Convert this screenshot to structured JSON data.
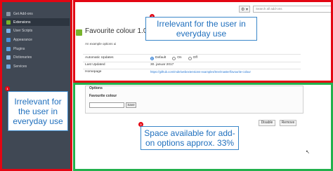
{
  "sidebar": {
    "items": [
      {
        "label": "Get Add-ons",
        "icon": "get-addons-icon",
        "color": "#8a95a3",
        "active": false
      },
      {
        "label": "Extensions",
        "icon": "extensions-icon",
        "color": "#78b32c",
        "active": true
      },
      {
        "label": "User Scripts",
        "icon": "user-scripts-icon",
        "color": "#7bb0e6",
        "active": false
      },
      {
        "label": "Appearance",
        "icon": "appearance-icon",
        "color": "#4a90d9",
        "active": false
      },
      {
        "label": "Plugins",
        "icon": "plugins-icon",
        "color": "#5ba0e0",
        "active": false
      },
      {
        "label": "Dictionaries",
        "icon": "dictionaries-icon",
        "color": "#8fb8e0",
        "active": false
      },
      {
        "label": "Services",
        "icon": "services-icon",
        "color": "#6fa4d8",
        "active": false
      }
    ]
  },
  "toolbar": {
    "gear_label": "⚙ ▾",
    "search_placeholder": "Search all add-ons"
  },
  "addon": {
    "title": "Favourite colour 1.0",
    "description": "An example options ui",
    "details": {
      "auto_updates_label": "Automatic Updates",
      "radio_default": "Default",
      "radio_on": "On",
      "radio_off": "Off",
      "last_updated_label": "Last Updated",
      "last_updated_value": "30. januar 2017",
      "homepage_label": "Homepage",
      "homepage_value": "https://github.com/mdn/webextensions-examples/tree/master/favourite-colour"
    }
  },
  "options": {
    "legend": "Options",
    "field_label": "Favourite colour",
    "field_value": "",
    "save_label": "Save"
  },
  "actions": {
    "disable_label": "Disable",
    "remove_label": "Remove"
  },
  "annotations": {
    "left": {
      "badge": "1",
      "text": "Irrelevant for the user in everyday use"
    },
    "top": {
      "badge": "2",
      "text": "Irrelevant for the user in everyday use"
    },
    "bottom": {
      "badge": "3",
      "text": "Space available for add-on options approx. 33%"
    }
  },
  "colors": {
    "frame_red": "#e30613",
    "frame_green": "#22b14c",
    "callout_blue": "#1f6fbd",
    "sidebar_bg": "#404854"
  }
}
